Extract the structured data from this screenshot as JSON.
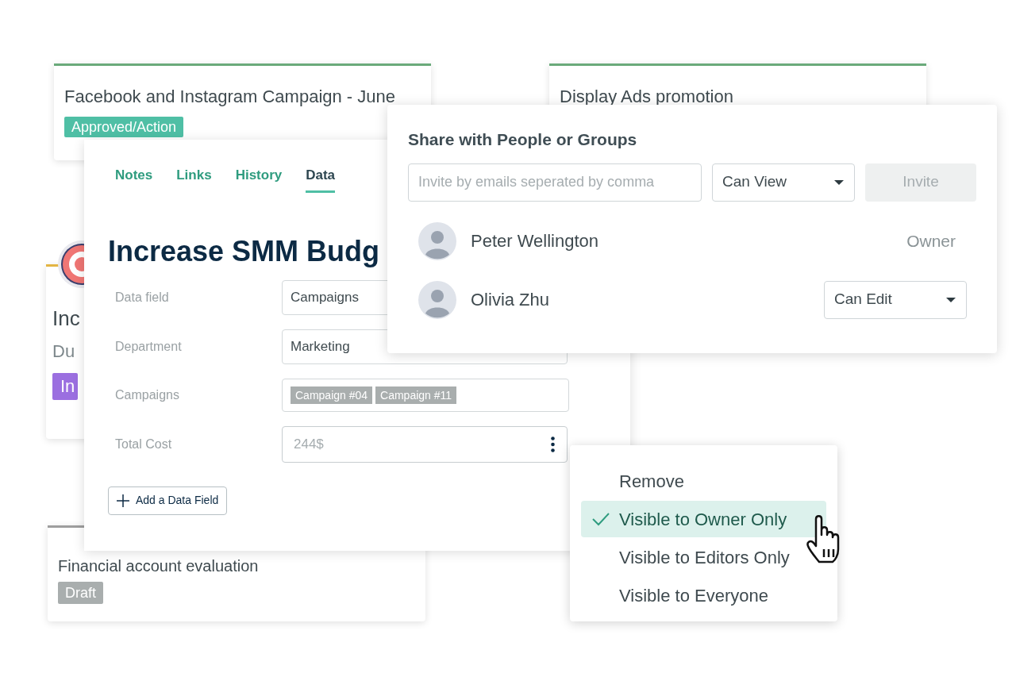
{
  "cards": [
    {
      "title": "Facebook and Instagram Campaign - June",
      "badge": {
        "text": "Approved/Action",
        "color": "#4fbfa5"
      }
    },
    {
      "title": "Display Ads promotion"
    },
    {
      "title": "Inc",
      "subtitle": "Du",
      "badge": {
        "text": "In",
        "color": "#9b6fe0"
      }
    },
    {
      "title": "Financial account evaluation",
      "badge": {
        "text": "Draft",
        "color": "#a9aeae"
      }
    }
  ],
  "detail": {
    "tabs": [
      {
        "label": "Notes",
        "selected": false
      },
      {
        "label": "Links",
        "selected": false
      },
      {
        "label": "History",
        "selected": false
      },
      {
        "label": "Data",
        "selected": true
      }
    ],
    "title": "Increase SMM Budg",
    "fields": [
      {
        "label": "Data field",
        "kind": "text",
        "value": "Campaigns"
      },
      {
        "label": "Department",
        "kind": "select",
        "value": "Marketing"
      },
      {
        "label": "Campaigns",
        "kind": "tags",
        "tags": [
          "Campaign #04",
          "Campaign #11"
        ]
      },
      {
        "label": "Total Cost",
        "kind": "menu",
        "placeholder": "244$"
      }
    ],
    "add_button": "Add a Data Field"
  },
  "share": {
    "title": "Share with People or Groups",
    "invite_placeholder": "Invite by emails seperated by comma",
    "permission": "Can View",
    "invite_button": {
      "label": "Invite",
      "disabled": true
    },
    "people": [
      {
        "name": "Peter Wellington",
        "kind": "label",
        "role": "Owner"
      },
      {
        "name": "Olivia Zhu",
        "kind": "select",
        "role": "Can Edit"
      }
    ]
  },
  "menu": [
    {
      "label": "Remove",
      "selected": false
    },
    {
      "label": "Visible to Owner Only",
      "selected": true
    },
    {
      "label": "Visible to Editors Only",
      "selected": false
    },
    {
      "label": "Visible to Everyone",
      "selected": false
    }
  ]
}
